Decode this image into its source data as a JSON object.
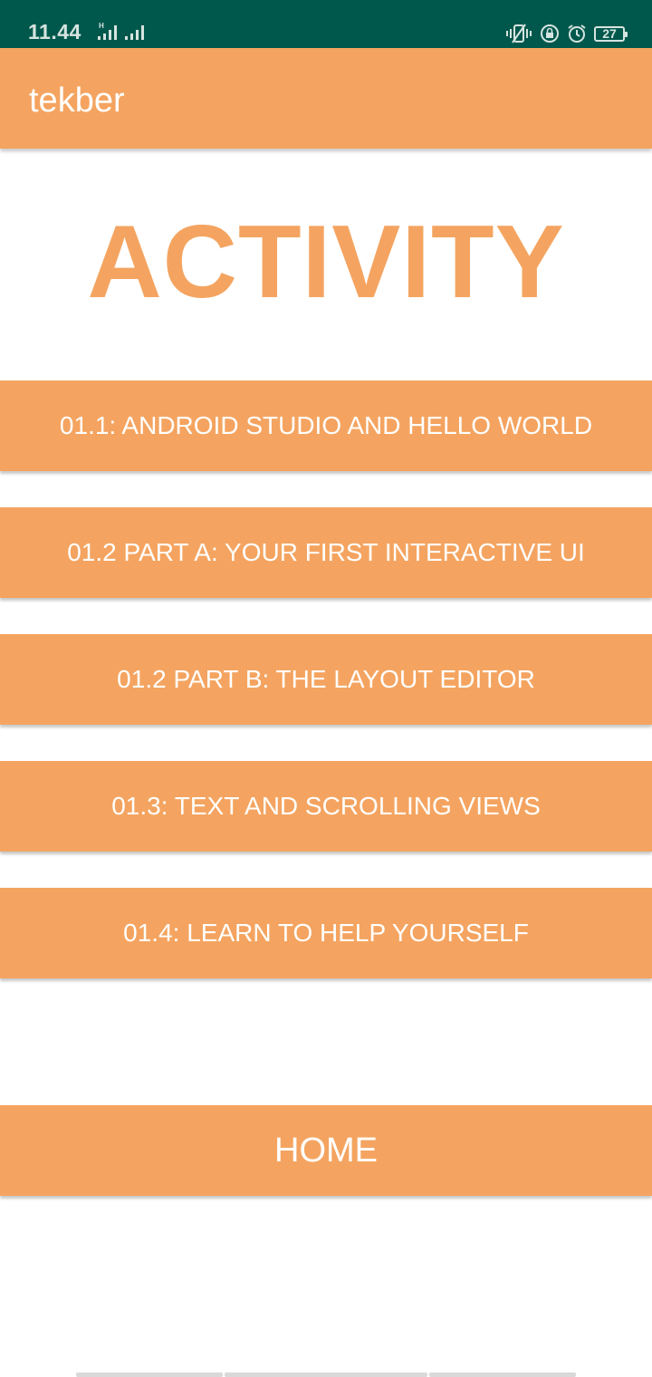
{
  "status_bar": {
    "time": "11.44",
    "signal_label": "H",
    "battery_level": "27"
  },
  "app_bar": {
    "title": "tekber"
  },
  "main": {
    "heading": "ACTIVITY",
    "buttons": [
      {
        "label": "01.1: ANDROID STUDIO AND HELLO WORLD"
      },
      {
        "label": "01.2 PART A: YOUR FIRST INTERACTIVE UI"
      },
      {
        "label": "01.2 PART B: THE LAYOUT EDITOR"
      },
      {
        "label": "01.3: TEXT AND SCROLLING VIEWS"
      },
      {
        "label": "01.4: LEARN TO HELP YOURSELF"
      }
    ],
    "home_button": {
      "label": "HOME"
    }
  },
  "colors": {
    "status_bar": "#00584c",
    "accent": "#f4a460",
    "text_on_accent": "#ffffff"
  }
}
